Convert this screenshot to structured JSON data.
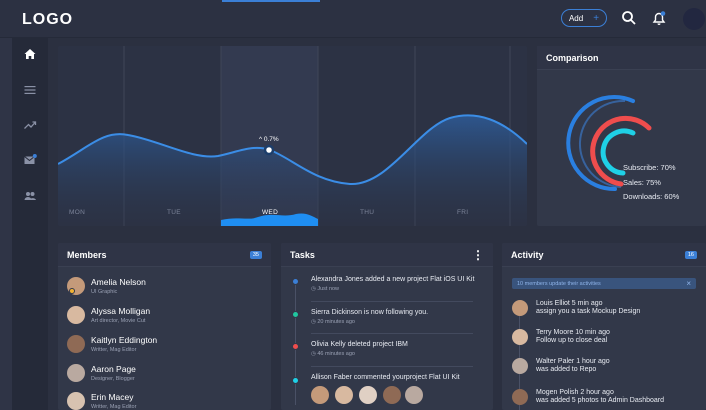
{
  "header": {
    "logo": "LOGO",
    "add_label": "Add",
    "add_plus": "+"
  },
  "icons": {
    "search": "search-icon",
    "bell": "bell-icon",
    "home": "home-icon",
    "list": "list-icon",
    "trend": "trending-icon",
    "mail": "mail-icon",
    "users": "users-icon"
  },
  "colors": {
    "accent": "#3b7fd6",
    "background": "#2b3040",
    "panel": "#323849",
    "red": "#ef4d4d",
    "cyan": "#1fd0e6"
  },
  "chart": {
    "days": [
      "MON",
      "TUE",
      "WED",
      "THU",
      "FRI"
    ],
    "tooltip": "^ 0.7%"
  },
  "comparison": {
    "title": "Comparison",
    "items": [
      {
        "label": "Subscribe: 70%",
        "color": "#3b7fd6",
        "value": 70
      },
      {
        "label": "Sales: 75%",
        "color": "#ef4d4d",
        "value": 75
      },
      {
        "label": "Downloads: 60%",
        "color": "#1fd0e6",
        "value": 60
      }
    ]
  },
  "members": {
    "title": "Members",
    "badge": "35",
    "list": [
      {
        "name": "Amelia Nelson",
        "role": "UI Graphic"
      },
      {
        "name": "Alyssa Molligan",
        "role": "Art director, Movie Cut"
      },
      {
        "name": "Kaitlyn Eddington",
        "role": "Writter, Mag Editor"
      },
      {
        "name": "Aaron Page",
        "role": "Designer, Blogger"
      },
      {
        "name": "Erin Macey",
        "role": "Writter, Mag Editor"
      }
    ]
  },
  "tasks": {
    "title": "Tasks",
    "menu": "⋮",
    "list": [
      {
        "text": "Alexandra Jones added a new project Flat iOS UI Kit",
        "time": "Just now",
        "color": "#3b7fd6"
      },
      {
        "text": "Sierra Dickinson is now following you.",
        "time": "20 minutes ago",
        "color": "#21c7a0"
      },
      {
        "text": "Olivia Kelly deleted project IBM",
        "time": "46 minutes ago",
        "color": "#ef4d4d"
      },
      {
        "text": "Allison Faber commented yourproject Flat UI Kit",
        "time": "",
        "color": "#1fd0e6"
      }
    ]
  },
  "activity": {
    "title": "Activity",
    "badge": "16",
    "banner": "10 members update their activities",
    "banner_close": "×",
    "list": [
      {
        "who": "Louis Elliot 5 min ago",
        "what": "assign you a task Mockup Design"
      },
      {
        "who": "Terry Moore 10 min ago",
        "what": "Follow up to close deal"
      },
      {
        "who": "Walter Paler 1 hour ago",
        "what": "was added to Repo"
      },
      {
        "who": "Mogen Polish 2 hour ago",
        "what": "was added 5 photos to Admin Dashboard"
      }
    ]
  }
}
